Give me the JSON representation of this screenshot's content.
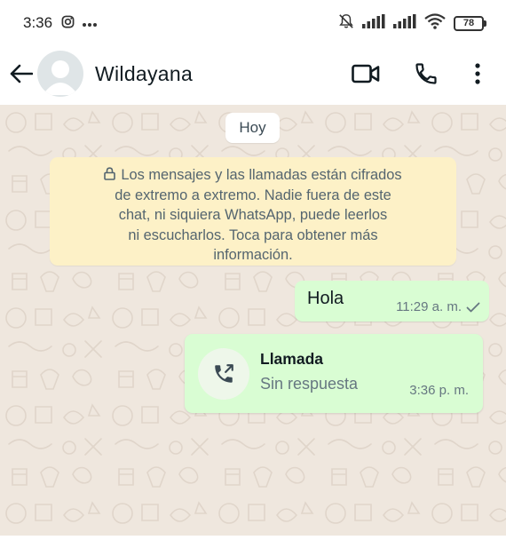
{
  "status_bar": {
    "time": "3:36",
    "battery_level": "78",
    "icons": [
      "instagram-notification-icon",
      "more-notifications-icon",
      "muted-bell-icon",
      "signal-bars-icon",
      "signal-bars-icon",
      "wifi-icon",
      "battery-icon"
    ]
  },
  "header": {
    "contact_name": "Wildayana",
    "icons": [
      "back-arrow-icon",
      "avatar",
      "video-call-icon",
      "voice-call-icon",
      "more-options-icon"
    ]
  },
  "chat": {
    "date_chip": "Hoy",
    "encryption_notice": {
      "lines": [
        "Los mensajes y las llamadas están cifrados",
        "de extremo a extremo. Nadie fuera de este",
        "chat, ni siquiera WhatsApp, puede leerlos",
        "ni escucharlos. Toca para obtener más",
        "información."
      ]
    },
    "messages": [
      {
        "type": "text",
        "direction": "outgoing",
        "text": "Hola",
        "time": "11:29 a. m.",
        "status": "sent"
      }
    ],
    "call": {
      "title": "Llamada",
      "subtitle": "Sin respuesta",
      "time": "3:36 p. m."
    }
  },
  "colors": {
    "wallpaper": "#efe7de",
    "outgoing_bubble": "#d9fdd3",
    "notice_bg": "#fdf1c7",
    "meta_text": "#667781"
  }
}
